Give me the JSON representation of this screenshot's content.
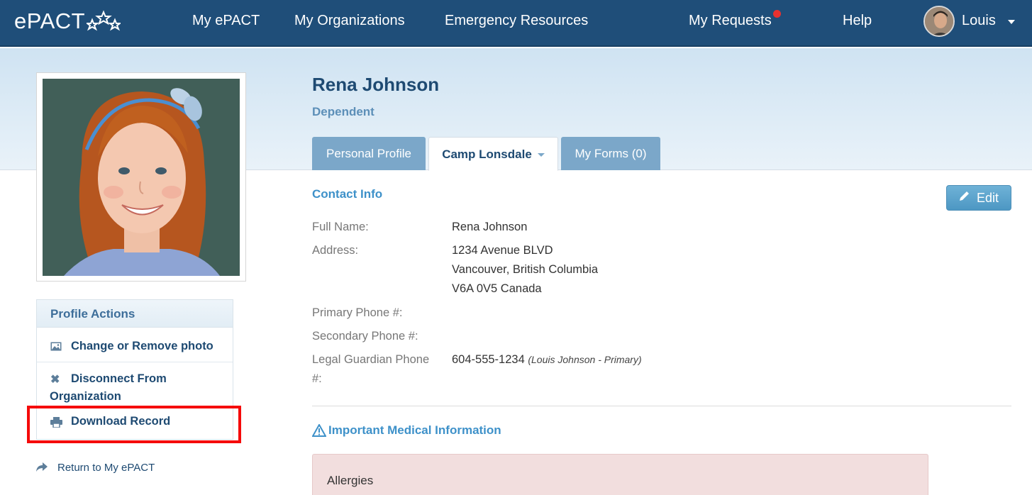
{
  "nav": {
    "logo": "ePACT",
    "items": [
      "My ePACT",
      "My Organizations",
      "Emergency Resources",
      "My Requests",
      "Help"
    ],
    "user_name": "Louis"
  },
  "profile": {
    "name": "Rena Johnson",
    "role": "Dependent"
  },
  "tabs": {
    "personal": "Personal Profile",
    "camp": "Camp Lonsdale",
    "forms": "My Forms (0)"
  },
  "actions": {
    "title": "Profile Actions",
    "change_photo": "Change or Remove photo",
    "disconnect_line1": "Disconnect From",
    "disconnect_line2": "Organization",
    "download": "Download Record"
  },
  "return_link": "Return to My ePACT",
  "contact": {
    "title": "Contact Info",
    "edit_label": "Edit",
    "full_name_label": "Full Name:",
    "full_name": "Rena Johnson",
    "address_label": "Address:",
    "address_line1": "1234 Avenue BLVD",
    "address_line2": "Vancouver, British Columbia",
    "address_line3": "V6A 0V5 Canada",
    "primary_phone_label": "Primary Phone #:",
    "secondary_phone_label": "Secondary Phone #:",
    "guardian_phone_label_line1": "Legal Guardian Phone",
    "guardian_phone_label_line2": "#:",
    "guardian_phone": "604-555-1234",
    "guardian_note": "(Louis Johnson - Primary)"
  },
  "medical": {
    "title": "Important Medical Information",
    "allergies_label": "Allergies"
  },
  "colors": {
    "nav_bg": "#1f4e79",
    "accent": "#3e91c9",
    "highlight": "#f50a0a",
    "notification": "#e8312f"
  }
}
